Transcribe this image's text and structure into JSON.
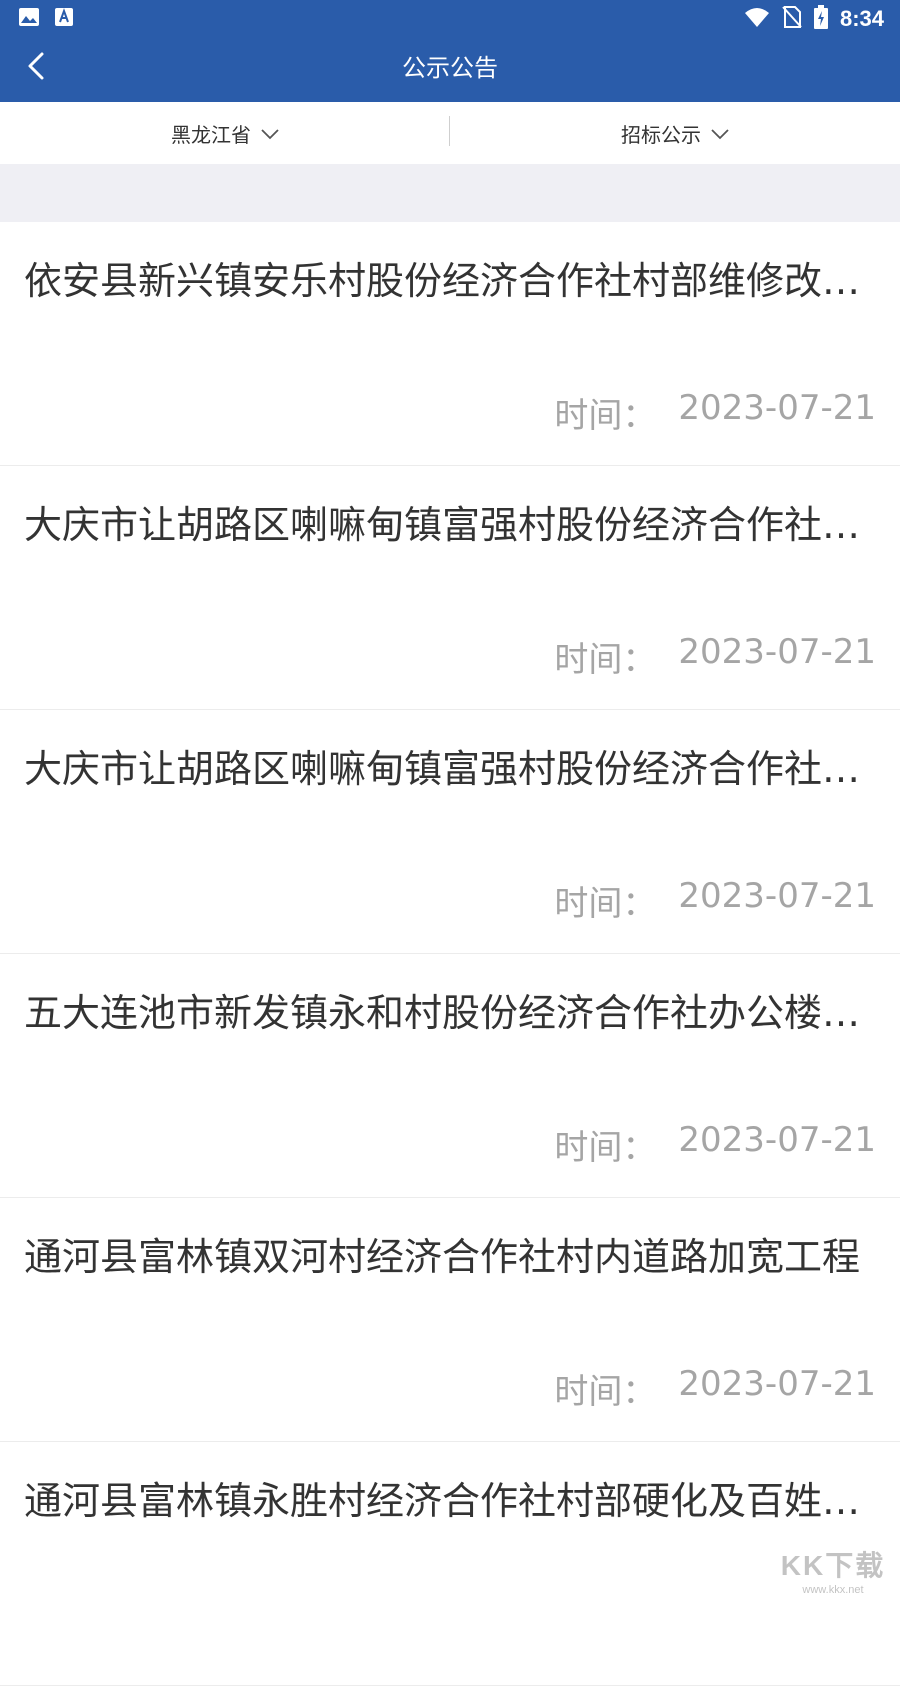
{
  "status_bar": {
    "time": "8:34",
    "icons": [
      "image-icon",
      "text-a-icon",
      "wifi-icon",
      "no-sim-icon",
      "battery-charging-icon"
    ]
  },
  "app_bar": {
    "title": "公示公告",
    "back_icon": "chevron-left-icon"
  },
  "filters": [
    {
      "label": "黑龙江省",
      "icon": "chevron-down-icon"
    },
    {
      "label": "招标公示",
      "icon": "chevron-down-icon"
    }
  ],
  "list": {
    "time_label": "时间：",
    "items": [
      {
        "title": "依安县新兴镇安乐村股份经济合作社村部维修改造工程",
        "date": "2023-07-21"
      },
      {
        "title": "大庆市让胡路区喇嘛甸镇富强村股份经济合作社项目",
        "date": "2023-07-21"
      },
      {
        "title": "大庆市让胡路区喇嘛甸镇富强村股份经济合作社工程",
        "date": "2023-07-21"
      },
      {
        "title": "五大连池市新发镇永和村股份经济合作社办公楼项目",
        "date": "2023-07-21"
      },
      {
        "title": "通河县富林镇双河村经济合作社村内道路加宽工程",
        "date": "2023-07-21"
      },
      {
        "title": "通河县富林镇永胜村经济合作社村部硬化及百姓工程",
        "date": ""
      }
    ]
  },
  "watermark": {
    "big": "KK下载",
    "small": "www.kkx.net"
  },
  "colors": {
    "primary": "#2a5caa",
    "text": "#333333",
    "muted": "#a5a5a5",
    "gap": "#efeff4"
  }
}
